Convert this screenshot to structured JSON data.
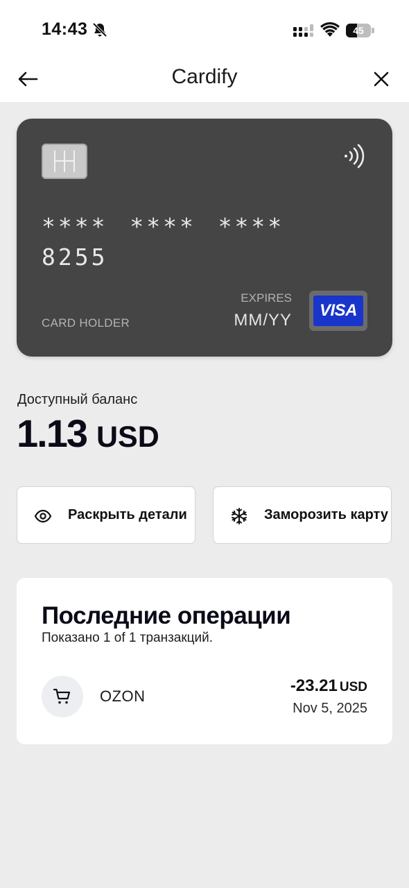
{
  "status_bar": {
    "time": "14:43",
    "battery_level": "45",
    "battery_fraction": 0.45,
    "icons": [
      "bell-slash-icon",
      "signal-icon",
      "wifi-icon",
      "battery-icon"
    ]
  },
  "header": {
    "title": "Cardify",
    "back_icon": "arrow-left-icon",
    "close_icon": "close-icon"
  },
  "card": {
    "number_masked": "**** **** **** 8255",
    "holder_label": "CARD HOLDER",
    "expires_label": "EXPIRES",
    "expires_value": "MM/YY",
    "network": "VISA",
    "colors": {
      "card_bg": "#454545",
      "visa_blue": "#1a35c9"
    }
  },
  "balance": {
    "label": "Доступный баланс",
    "amount": "1.13",
    "currency": "USD"
  },
  "actions": {
    "reveal": {
      "label": "Раскрыть детали",
      "icon": "eye-icon"
    },
    "freeze": {
      "label": "Заморозить карту",
      "icon": "snowflake-icon"
    }
  },
  "transactions": {
    "title": "Последние операции",
    "subtitle": "Показано 1 of 1 транзакций.",
    "items": [
      {
        "merchant": "OZON",
        "amount": "-23.21",
        "currency": "USD",
        "date": "Nov 5, 2025",
        "icon": "cart-icon"
      }
    ]
  }
}
